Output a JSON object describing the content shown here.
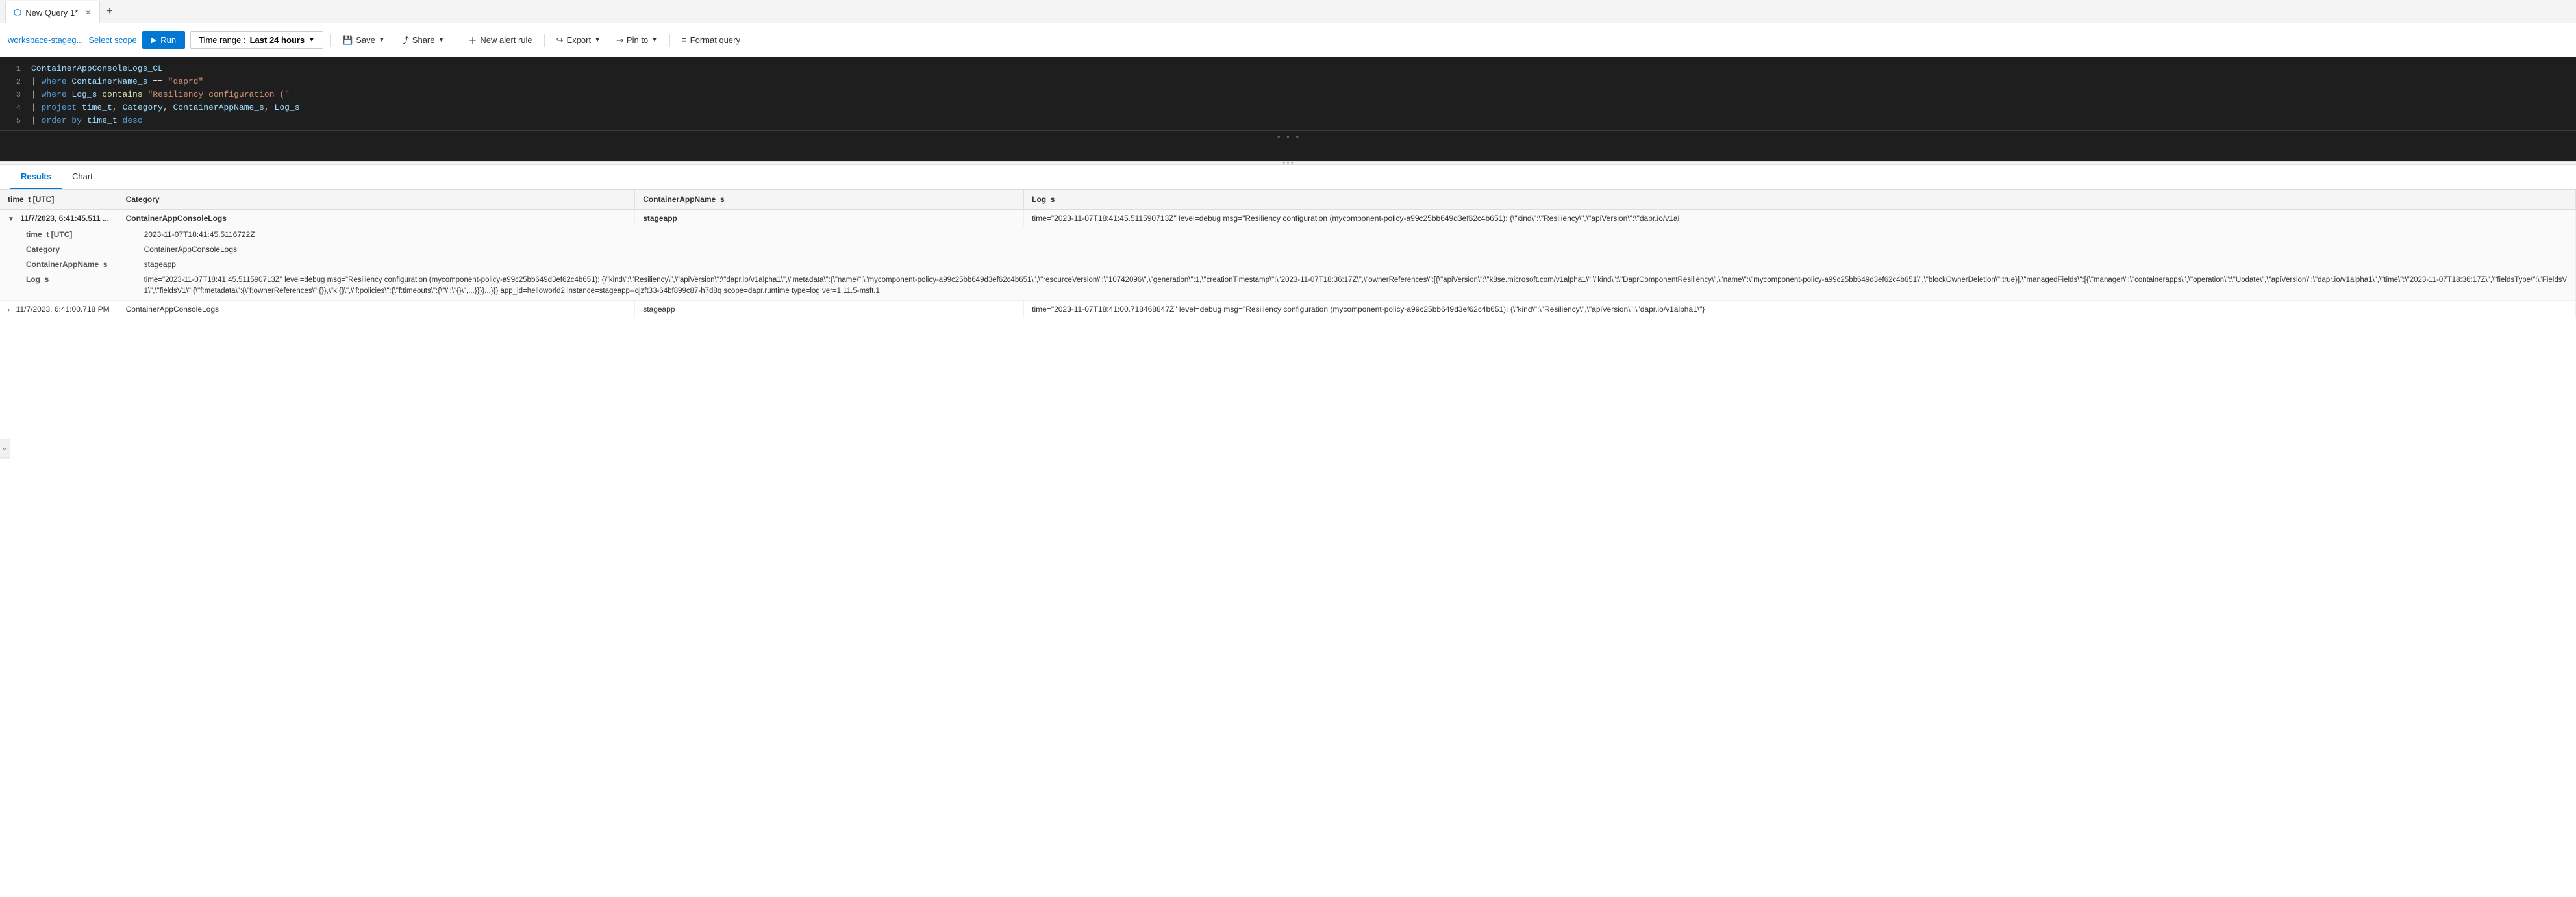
{
  "tab": {
    "title": "New Query 1*",
    "close_label": "×",
    "new_tab_label": "+"
  },
  "toolbar": {
    "workspace": "workspace-stageg...",
    "scope_label": "Select scope",
    "run_label": "Run",
    "time_range_prefix": "Time range :",
    "time_range_value": "Last 24 hours",
    "save_label": "Save",
    "share_label": "Share",
    "new_alert_label": "New alert rule",
    "export_label": "Export",
    "pin_label": "Pin to",
    "format_label": "Format query"
  },
  "editor": {
    "lines": [
      {
        "num": 1,
        "content": "ContainerAppConsoleLogs_CL"
      },
      {
        "num": 2,
        "content": "| where ContainerName_s == \"daprd\""
      },
      {
        "num": 3,
        "content": "| where Log_s contains \"Resiliency configuration (\""
      },
      {
        "num": 4,
        "content": "| project time_t, Category, ContainerAppName_s, Log_s"
      },
      {
        "num": 5,
        "content": "| order by time_t desc"
      }
    ]
  },
  "results": {
    "tabs": [
      "Results",
      "Chart"
    ],
    "active_tab": "Results",
    "columns": [
      "time_t [UTC]",
      "Category",
      "ContainerAppName_s",
      "Log_s"
    ],
    "rows": [
      {
        "expanded": true,
        "time": "11/7/2023, 6:41:45.511 ...",
        "category": "ContainerAppConsoleLogs",
        "appname": "stageapp",
        "log": "time=\"2023-11-07T18:41:45.511590713Z\" level=debug msg=\"Resiliency configuration (mycomponent-policy-a99c25bb649d3ef62c4b651): {\\\"kind\\\":\\\"Resiliency\\\",\\\"apiVersion\\\":\\\"dapr.io/v1al",
        "details": [
          {
            "label": "time_t [UTC]",
            "value": "2023-11-07T18:41:45.5116722Z"
          },
          {
            "label": "Category",
            "value": "ContainerAppConsoleLogs"
          },
          {
            "label": "ContainerAppName_s",
            "value": "stageapp"
          },
          {
            "label": "Log_s",
            "value": "time=\"2023-11-07T18:41:45.511590713Z\" level=debug msg=\"Resiliency configuration (mycomponent-policy-a99c25bb649d3ef62c4b651): {\\\"kind\\\":\\\"Resiliency\\\",\\\"apiVersion\\\":\\\"dapr.io/v1alpha1\\\",\\\"metadata\\\":{\\\"name\\\":\\\"mycomponent-policy-a99c25bb649d3ef62c4b651\\\",\\\"resourceVersion\\\":\\\"10742096\\\",\\\"generation\\\":1,\\\"creationTimestamp\\\":\\\"2023-11-07T18:36:17Z\\\",\\\"ownerReferences\\\":[{\\\"apiVersion\\\":\\\"k8se.microsoft.com/v1alpha1\\\",\\\"kind\\\":\\\"DaprComponentResiliency\\\",\\\"name\\\":\\\"mycomponent-policy-a99c25bb649d3ef62c4b651\\\",\\\"blockOwnerDeletion\\\":true}],\\\"managedFields\\\":[{\\\"manager\\\":\\\"containerapps\\\",\\\"operation\\\":\\\"Update\\\",\\\"apiVersion\\\":\\\"dapr.io/v1alpha1\\\",\\\"time\\\":\\\"2023-11-07T18:36:17Z\\\",\\\"fieldsType\\\":\\\"FieldsV1\\\",\\\"fieldsV1\\\":{\\\"f:metadata\\\":{\\\"f:ownerReferences\\\":{}},\\\"k:{}\\\",\\\"f:policies\\\":{\\\"f:timeouts\\\":{\\\"\\\":\\\"{}\\\",...}}}}...}}} app_id=helloworld2 instance=stageapp--qjzft33-64bf899c87-h7d8q scope=dapr.runtime type=log ver=1.11.5-msft.1"
          }
        ]
      },
      {
        "expanded": false,
        "time": "11/7/2023, 6:41:00.718 PM",
        "category": "ContainerAppConsoleLogs",
        "appname": "stageapp",
        "log": "time=\"2023-11-07T18:41:00.718468847Z\" level=debug msg=\"Resiliency configuration (mycomponent-policy-a99c25bb649d3ef62c4b651): {\\\"kind\\\":\\\"Resiliency\\\",\\\"apiVersion\\\":\\\"dapr.io/v1alpha1\\\"}"
      }
    ]
  },
  "icons": {
    "play": "▶",
    "chevron_down": "⌄",
    "save": "💾",
    "share": "↗",
    "alert": "+",
    "export": "↪",
    "pin": "📌",
    "format": "≡",
    "expand": "›",
    "collapse": "⌄",
    "azure": "⬡"
  }
}
